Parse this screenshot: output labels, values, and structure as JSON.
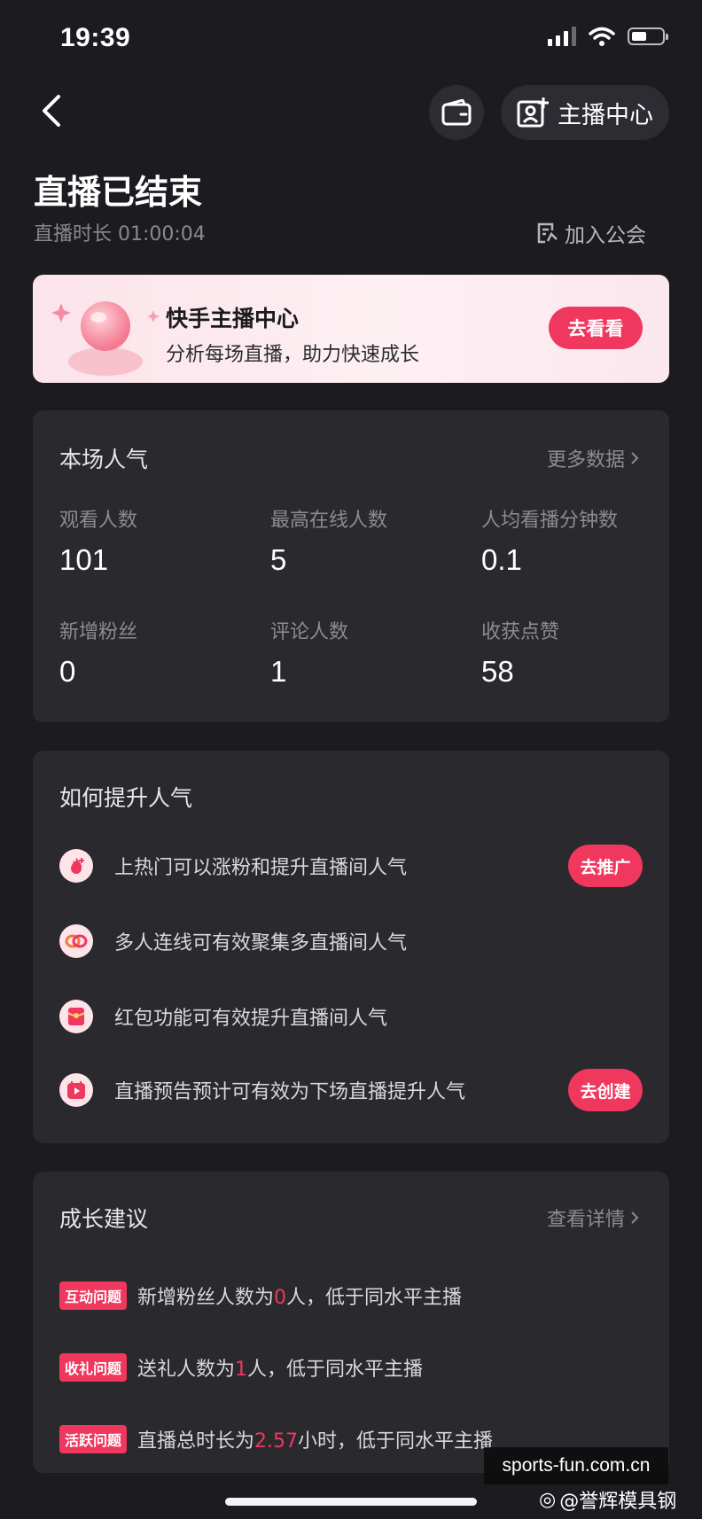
{
  "status_bar": {
    "time": "19:39"
  },
  "nav": {
    "center_button_label": "主播中心"
  },
  "header": {
    "title": "直播已结束",
    "duration": "直播时长 01:00:04",
    "join_label": "加入公会"
  },
  "banner": {
    "title": "快手主播中心",
    "subtitle": "分析每场直播，助力快速成长",
    "button_label": "去看看"
  },
  "popularity": {
    "title": "本场人气",
    "more_label": "更多数据",
    "stats": [
      {
        "label": "观看人数",
        "value": "101"
      },
      {
        "label": "最高在线人数",
        "value": "5"
      },
      {
        "label": "人均看播分钟数",
        "value": "0.1"
      },
      {
        "label": "新增粉丝",
        "value": "0"
      },
      {
        "label": "评论人数",
        "value": "1"
      },
      {
        "label": "收获点赞",
        "value": "58"
      }
    ]
  },
  "improve": {
    "title": "如何提升人气",
    "items": [
      {
        "text": "上热门可以涨粉和提升直播间人气",
        "icon": "hot-icon",
        "button": "去推广"
      },
      {
        "text": "多人连线可有效聚集多直播间人气",
        "icon": "link-icon"
      },
      {
        "text": "红包功能可有效提升直播间人气",
        "icon": "red-packet-icon"
      },
      {
        "text": "直播预告预计可有效为下场直播提升人气",
        "icon": "calendar-icon",
        "button": "去创建"
      }
    ]
  },
  "growth": {
    "title": "成长建议",
    "detail_label": "查看详情",
    "items": [
      {
        "tag": "互动问题",
        "before": "新增粉丝人数为",
        "value": "0",
        "after": "人，低于同水平主播"
      },
      {
        "tag": "收礼问题",
        "before": "送礼人数为",
        "value": "1",
        "after": "人，低于同水平主播"
      },
      {
        "tag": "活跃问题",
        "before": "直播总时长为",
        "value": "2.57",
        "after": "小时，低于同水平主播"
      }
    ]
  },
  "watermark": {
    "site": "sports-fun.com.cn",
    "author": "@誉辉模具钢"
  },
  "colors": {
    "background": "#1c1b20",
    "card": "#2a292e",
    "accent": "#f0375e"
  }
}
